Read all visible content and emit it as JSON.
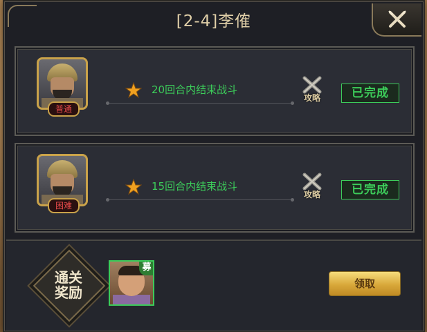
{
  "dialog": {
    "title": "[2-4]李傕"
  },
  "stages": [
    {
      "difficulty": "普通",
      "condition": "20回合内结束战斗",
      "strategy_label": "攻略",
      "status": "已完成"
    },
    {
      "difficulty": "困难",
      "condition": "15回合内结束战斗",
      "strategy_label": "攻略",
      "status": "已完成"
    }
  ],
  "reward": {
    "label_line1": "通关",
    "label_line2": "奖励",
    "item_badge": "募",
    "claim_label": "领取"
  },
  "colors": {
    "complete_green": "#3ccc5a",
    "title_gold": "#e0cfa8",
    "difficulty_red": "#e04848"
  },
  "icons": {
    "close": "close-x-icon",
    "star": "star-icon",
    "strategy": "crossed-swords-icon"
  }
}
